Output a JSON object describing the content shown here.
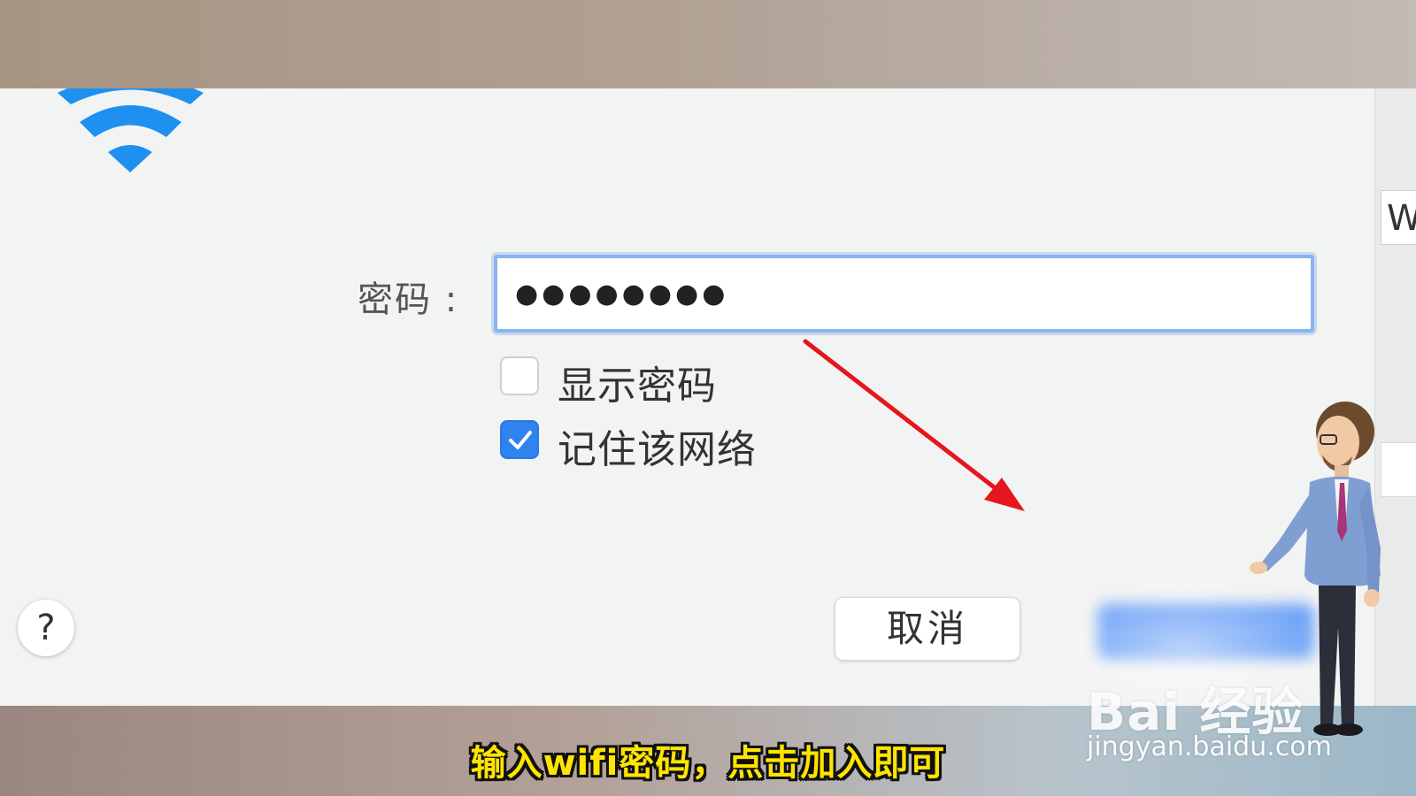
{
  "dialog": {
    "password_label": "密码 :",
    "password_value": "●●●●●●●●",
    "show_password": {
      "label": "显示密码",
      "checked": false
    },
    "remember_network": {
      "label": "记住该网络",
      "checked": true
    },
    "help_label": "?",
    "cancel_label": "取消",
    "side_panel_letter": "W"
  },
  "watermark": {
    "brand": "Bai  经验",
    "url": "jingyan.baidu.com"
  },
  "caption": "输入wifi密码，点击加入即可",
  "colors": {
    "wifi_icon": "#1e90f0",
    "checkbox_checked": "#2f83f0",
    "arrow": "#e5161d",
    "caption": "#ffe400"
  },
  "icons": [
    "wifi-icon",
    "checkmark-icon",
    "arrow-annotation",
    "presenter-character"
  ]
}
